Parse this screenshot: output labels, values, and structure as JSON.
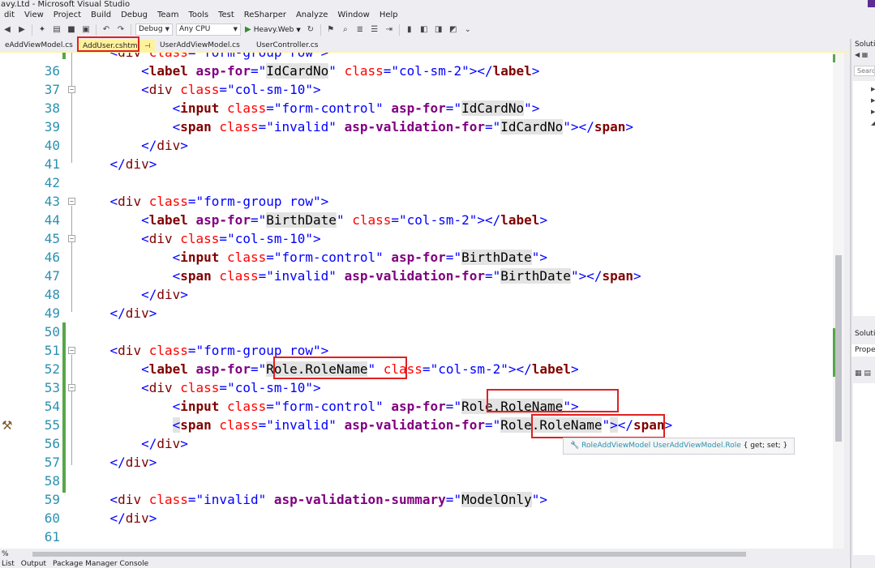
{
  "window": {
    "title": "avy.Ltd - Microsoft Visual Studio"
  },
  "menu": [
    "dit",
    "View",
    "Project",
    "Build",
    "Debug",
    "Team",
    "Tools",
    "Test",
    "ReSharper",
    "Analyze",
    "Window",
    "Help"
  ],
  "toolbar": {
    "config": "Debug",
    "platform": "Any CPU",
    "start_project": "Heavy.Web"
  },
  "tabs": [
    {
      "label": "eAddViewModel.cs",
      "active": false
    },
    {
      "label": "AddUser.cshtml",
      "active": true
    },
    {
      "label": "UserAddViewModel.cs",
      "active": false
    },
    {
      "label": "UserController.cs",
      "active": false
    }
  ],
  "line_numbers": [
    "36",
    "37",
    "38",
    "39",
    "40",
    "41",
    "42",
    "43",
    "44",
    "45",
    "46",
    "47",
    "48",
    "49",
    "50",
    "51",
    "52",
    "53",
    "54",
    "55",
    "56",
    "57",
    "58",
    "59",
    "60",
    "61"
  ],
  "tooltip": {
    "type_name": "RoleAddViewModel",
    "member": "UserAddViewModel.Role",
    "accessors": "{ get; set; }"
  },
  "status": {
    "zoom": "%"
  },
  "bottom_tabs": [
    "List",
    "Output",
    "Package Manager Console"
  ],
  "right_panel": {
    "title": "Solutio",
    "search": "Search",
    "title2": "Solutio",
    "properties": "Proper"
  },
  "colors": {
    "tag": "#800000",
    "attr": "#ff0000",
    "value": "#0000ff",
    "asp": "#800080",
    "line_number": "#2b91af",
    "changed": "#57a64a",
    "highlight_box": "#e02020"
  }
}
